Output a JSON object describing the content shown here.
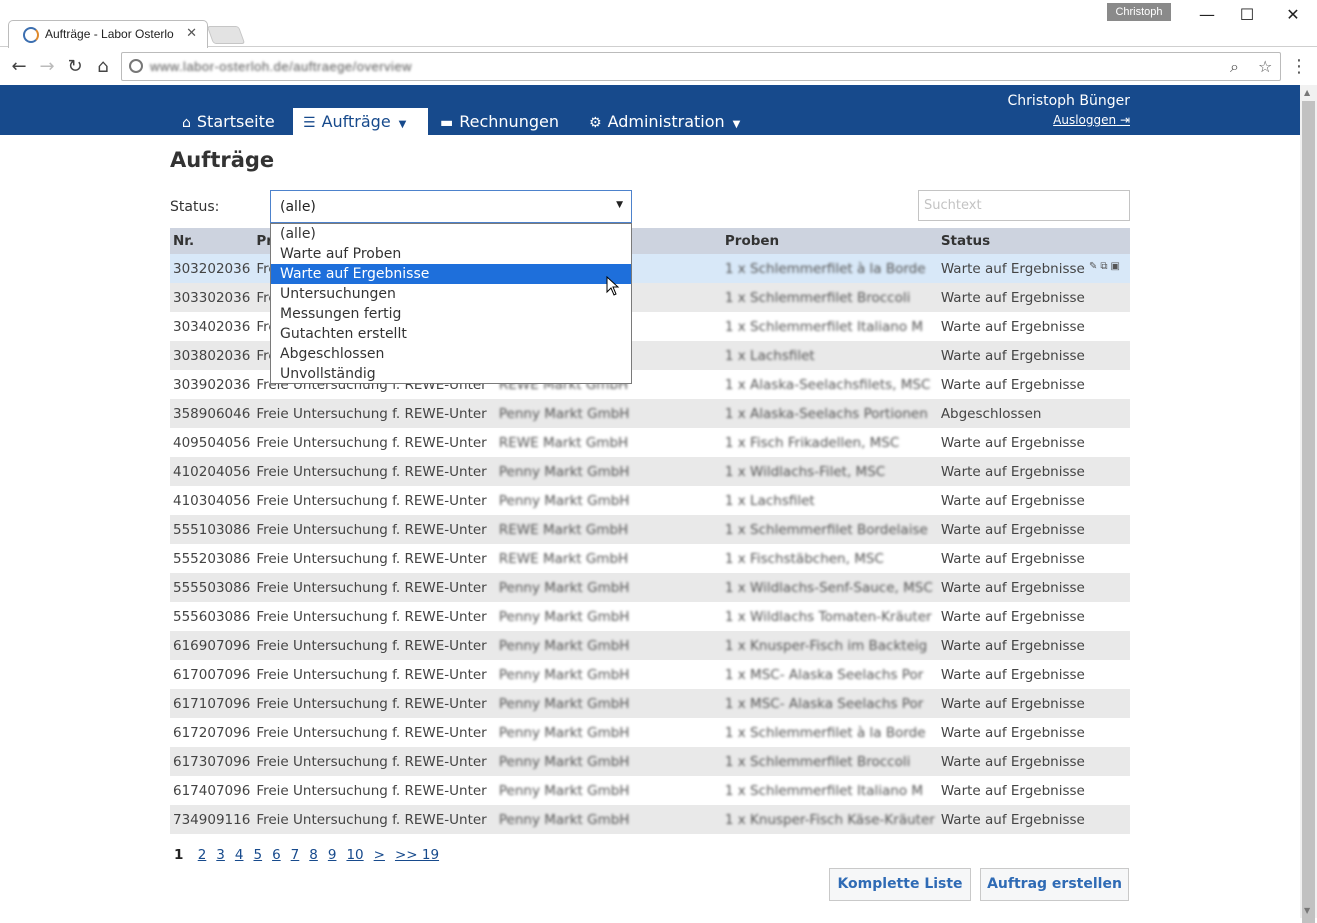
{
  "browser": {
    "tab_title": "Aufträge - Labor Osterlo",
    "profile": "Christoph",
    "url": "www.labor-osterloh.de/auftraege/overview"
  },
  "header": {
    "nav": [
      {
        "label": "Startseite",
        "icon": "home-icon"
      },
      {
        "label": "Aufträge",
        "icon": "list-icon"
      },
      {
        "label": "Rechnungen",
        "icon": "printer-icon"
      },
      {
        "label": "Administration",
        "icon": "gear-icon"
      }
    ],
    "user_name": "Christoph Bünger",
    "logout_label": "Ausloggen"
  },
  "page": {
    "title": "Aufträge",
    "status_label": "Status:",
    "status_value": "(alle)",
    "search_placeholder": "Suchtext"
  },
  "dropdown": {
    "options": [
      "(alle)",
      "Warte auf Proben",
      "Warte auf Ergebnisse",
      "Untersuchungen",
      "Messungen fertig",
      "Gutachten erstellt",
      "Abgeschlossen",
      "Unvollständig"
    ],
    "highlighted": "Warte auf Ergebnisse"
  },
  "table": {
    "columns": [
      "Nr.",
      "Pr",
      "",
      "Proben",
      "Status"
    ],
    "rows": [
      {
        "nr": "303202036",
        "pr": "Freie",
        "kunde": "",
        "proben": "1 x Schlemmerfilet à la Borde",
        "status": "Warte auf Ergebnisse"
      },
      {
        "nr": "303302036",
        "pr": "Fre",
        "kunde": "",
        "proben": "1 x Schlemmerfilet Broccoli",
        "status": "Warte auf Ergebnisse"
      },
      {
        "nr": "303402036",
        "pr": "Fre",
        "kunde": "",
        "proben": "1 x Schlemmerfilet Italiano M",
        "status": "Warte auf Ergebnisse"
      },
      {
        "nr": "303802036",
        "pr": "Fre",
        "kunde": "",
        "proben": "1 x Lachsfilet",
        "status": "Warte auf Ergebnisse"
      },
      {
        "nr": "303902036",
        "pr": "Freie Untersuchung f. REWE-Unter",
        "kunde": "REWE Markt GmbH",
        "proben": "1 x Alaska-Seelachsfilets, MSC",
        "status": "Warte auf Ergebnisse"
      },
      {
        "nr": "358906046",
        "pr": "Freie Untersuchung f. REWE-Unter",
        "kunde": "Penny Markt GmbH",
        "proben": "1 x Alaska-Seelachs Portionen",
        "status": "Abgeschlossen"
      },
      {
        "nr": "409504056",
        "pr": "Freie Untersuchung f. REWE-Unter",
        "kunde": "REWE Markt GmbH",
        "proben": "1 x Fisch Frikadellen, MSC",
        "status": "Warte auf Ergebnisse"
      },
      {
        "nr": "410204056",
        "pr": "Freie Untersuchung f. REWE-Unter",
        "kunde": "Penny Markt GmbH",
        "proben": "1 x Wildlachs-Filet, MSC",
        "status": "Warte auf Ergebnisse"
      },
      {
        "nr": "410304056",
        "pr": "Freie Untersuchung f. REWE-Unter",
        "kunde": "Penny Markt GmbH",
        "proben": "1 x Lachsfilet",
        "status": "Warte auf Ergebnisse"
      },
      {
        "nr": "555103086",
        "pr": "Freie Untersuchung f. REWE-Unter",
        "kunde": "REWE Markt GmbH",
        "proben": "1 x Schlemmerfilet Bordelaise",
        "status": "Warte auf Ergebnisse"
      },
      {
        "nr": "555203086",
        "pr": "Freie Untersuchung f. REWE-Unter",
        "kunde": "REWE Markt GmbH",
        "proben": "1 x Fischstäbchen, MSC",
        "status": "Warte auf Ergebnisse"
      },
      {
        "nr": "555503086",
        "pr": "Freie Untersuchung f. REWE-Unter",
        "kunde": "Penny Markt GmbH",
        "proben": "1 x Wildlachs-Senf-Sauce, MSC",
        "status": "Warte auf Ergebnisse"
      },
      {
        "nr": "555603086",
        "pr": "Freie Untersuchung f. REWE-Unter",
        "kunde": "Penny Markt GmbH",
        "proben": "1 x Wildlachs Tomaten-Kräuter",
        "status": "Warte auf Ergebnisse"
      },
      {
        "nr": "616907096",
        "pr": "Freie Untersuchung f. REWE-Unter",
        "kunde": "Penny Markt GmbH",
        "proben": "1 x Knusper-Fisch im Backteig",
        "status": "Warte auf Ergebnisse"
      },
      {
        "nr": "617007096",
        "pr": "Freie Untersuchung f. REWE-Unter",
        "kunde": "Penny Markt GmbH",
        "proben": "1 x MSC- Alaska Seelachs Por",
        "status": "Warte auf Ergebnisse"
      },
      {
        "nr": "617107096",
        "pr": "Freie Untersuchung f. REWE-Unter",
        "kunde": "Penny Markt GmbH",
        "proben": "1 x MSC- Alaska Seelachs Por",
        "status": "Warte auf Ergebnisse"
      },
      {
        "nr": "617207096",
        "pr": "Freie Untersuchung f. REWE-Unter",
        "kunde": "Penny Markt GmbH",
        "proben": "1 x Schlemmerfilet à la Borde",
        "status": "Warte auf Ergebnisse"
      },
      {
        "nr": "617307096",
        "pr": "Freie Untersuchung f. REWE-Unter",
        "kunde": "Penny Markt GmbH",
        "proben": "1 x Schlemmerfilet Broccoli",
        "status": "Warte auf Ergebnisse"
      },
      {
        "nr": "617407096",
        "pr": "Freie Untersuchung f. REWE-Unter",
        "kunde": "Penny Markt GmbH",
        "proben": "1 x Schlemmerfilet Italiano M",
        "status": "Warte auf Ergebnisse"
      },
      {
        "nr": "734909116",
        "pr": "Freie Untersuchung f. REWE-Unter",
        "kunde": "Penny Markt GmbH",
        "proben": "1 x Knusper-Fisch Käse-Kräuter",
        "status": "Warte auf Ergebnisse"
      }
    ]
  },
  "pagination": {
    "current": "1",
    "pages": [
      "2",
      "3",
      "4",
      "5",
      "6",
      "7",
      "8",
      "9",
      "10",
      ">",
      ">> 19"
    ]
  },
  "buttons": {
    "full_list": "Komplette Liste",
    "create_order": "Auftrag erstellen"
  },
  "colors": {
    "brand": "#174a8c",
    "selection": "#1e6fdb",
    "table_header": "#cdd3df"
  }
}
